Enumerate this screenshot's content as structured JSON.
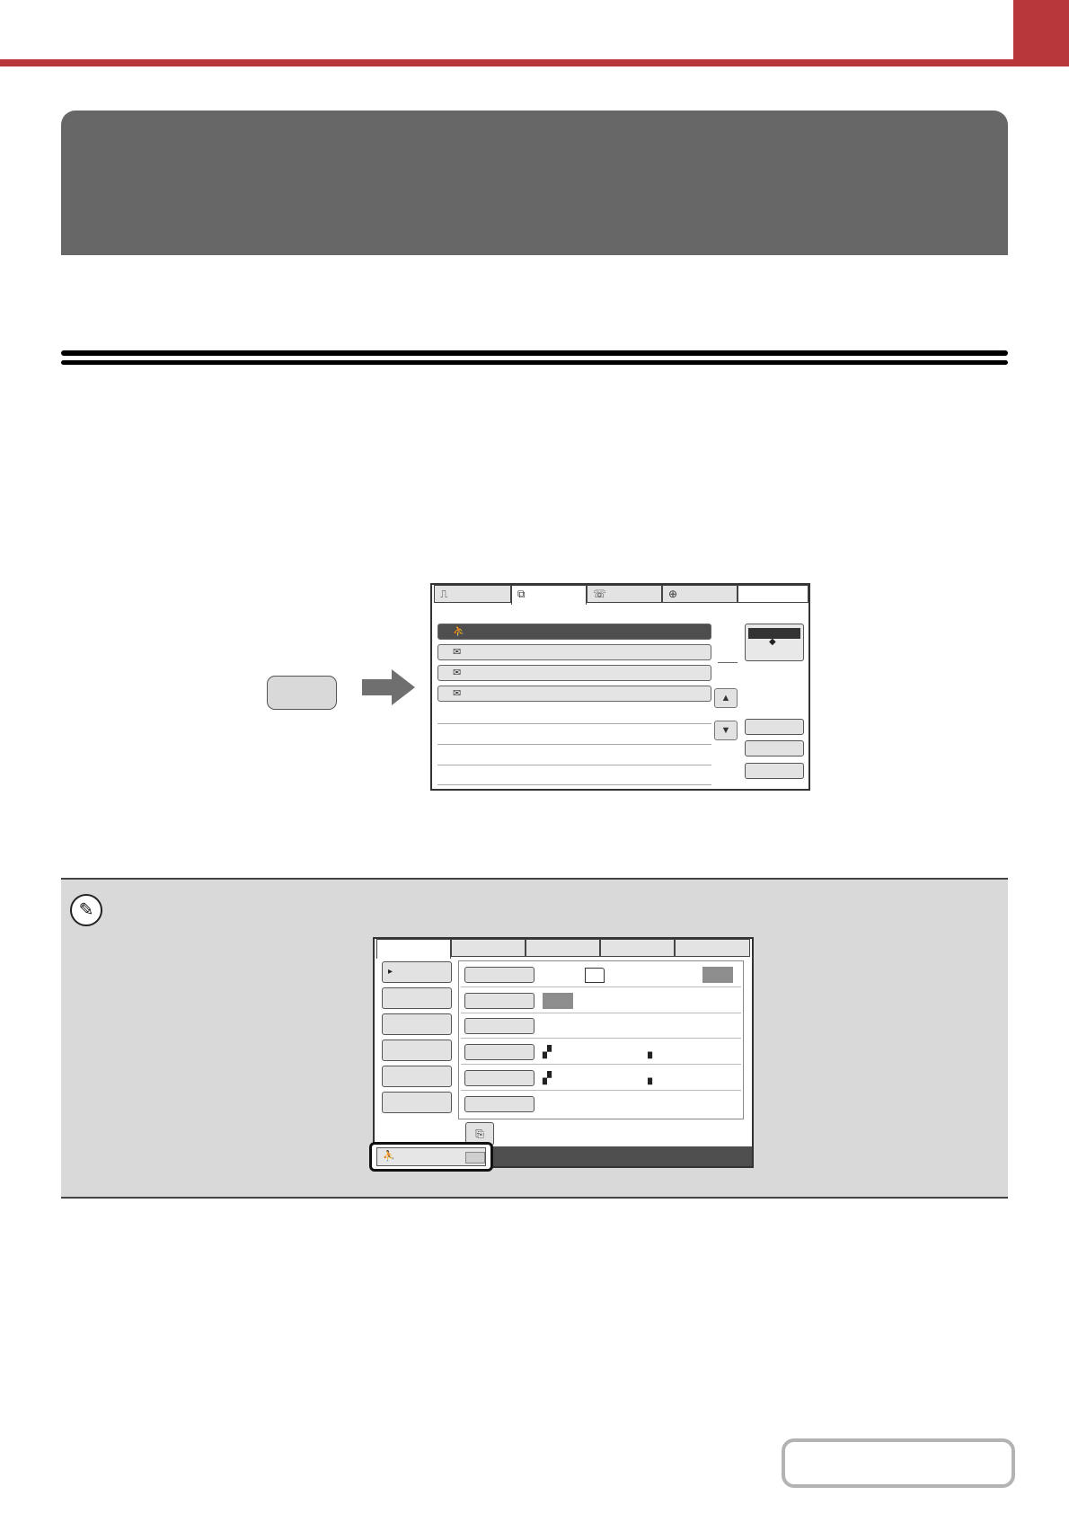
{
  "colors": {
    "accent": "#b8373a",
    "banner": "#676767",
    "note_background": "#d9d9d9",
    "selected_row": "#4e4e4e"
  },
  "address_screen": {
    "tabs": [
      {
        "icon": "scanner-icon",
        "glyph": "⎍"
      },
      {
        "icon": "internet-fax-icon",
        "glyph": "⧉"
      },
      {
        "icon": "fax-icon",
        "glyph": "☏"
      },
      {
        "icon": "network-icon",
        "glyph": "⊕"
      },
      {
        "icon": "",
        "glyph": ""
      }
    ],
    "active_tab": 1,
    "rows": [
      {
        "icon": "address-book-icon",
        "glyph": "⛹",
        "selected": true
      },
      {
        "icon": "email-icon",
        "glyph": "✉",
        "selected": false
      },
      {
        "icon": "email-icon",
        "glyph": "✉",
        "selected": false
      },
      {
        "icon": "email-icon",
        "glyph": "✉",
        "selected": false
      }
    ],
    "scroll_up_glyph": "▲",
    "scroll_down_glyph": "▼",
    "sort_glyph": "◆"
  },
  "note": {
    "icon": "pencil-note-icon",
    "glyph": "✎"
  },
  "send_screen": {
    "tab_count": 5,
    "left_buttons": [
      {
        "glyph": "▸",
        "active": true
      },
      {
        "glyph": "",
        "active": false
      },
      {
        "glyph": "",
        "active": false
      },
      {
        "glyph": "",
        "active": false
      },
      {
        "glyph": "",
        "active": false
      },
      {
        "glyph": "",
        "active": false
      }
    ],
    "preview_glyph": "⎘",
    "address_review_glyph": "⛹"
  }
}
